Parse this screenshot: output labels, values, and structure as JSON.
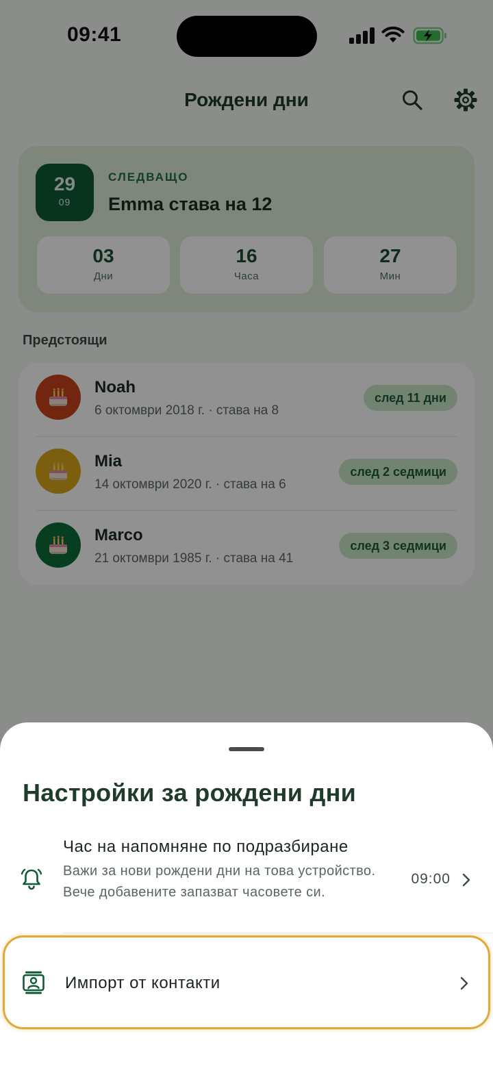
{
  "status_bar": {
    "time": "09:41"
  },
  "header": {
    "title": "Рождени дни",
    "search_icon": "search-icon",
    "settings_icon": "gear-icon"
  },
  "next": {
    "label": "СЛЕДВАЩО",
    "title": "Emma става на 12",
    "date_day": "29",
    "date_month": "09",
    "countdown": [
      {
        "value": "03",
        "label": "Дни"
      },
      {
        "value": "16",
        "label": "Часа"
      },
      {
        "value": "27",
        "label": "Мин"
      }
    ]
  },
  "upcoming": {
    "section_title": "Предстоящи",
    "items": [
      {
        "name": "Noah",
        "subtitle": "6 октомври 2018 г. · става на 8",
        "chip": "след 11 дни",
        "avatar_color": "#c8441c"
      },
      {
        "name": "Mia",
        "subtitle": "14 октомври 2020 г. · става на 6",
        "chip": "след 2 седмици",
        "avatar_color": "#d8a81c"
      },
      {
        "name": "Marco",
        "subtitle": "21 октомври 1985 г. · става на 41",
        "chip": "след 3 седмици",
        "avatar_color": "#0d6b3a"
      }
    ]
  },
  "sheet": {
    "title": "Настройки за рождени дни",
    "reminder": {
      "title": "Час на напомняне по подразбиране",
      "description": "Важи за нови рождени дни на това устройство. Вече добавените запазват часовете си.",
      "value": "09:00"
    },
    "import": {
      "title": "Импорт от контакти"
    }
  },
  "colors": {
    "accent": "#0f5a36",
    "focus": "#e2a93a"
  }
}
